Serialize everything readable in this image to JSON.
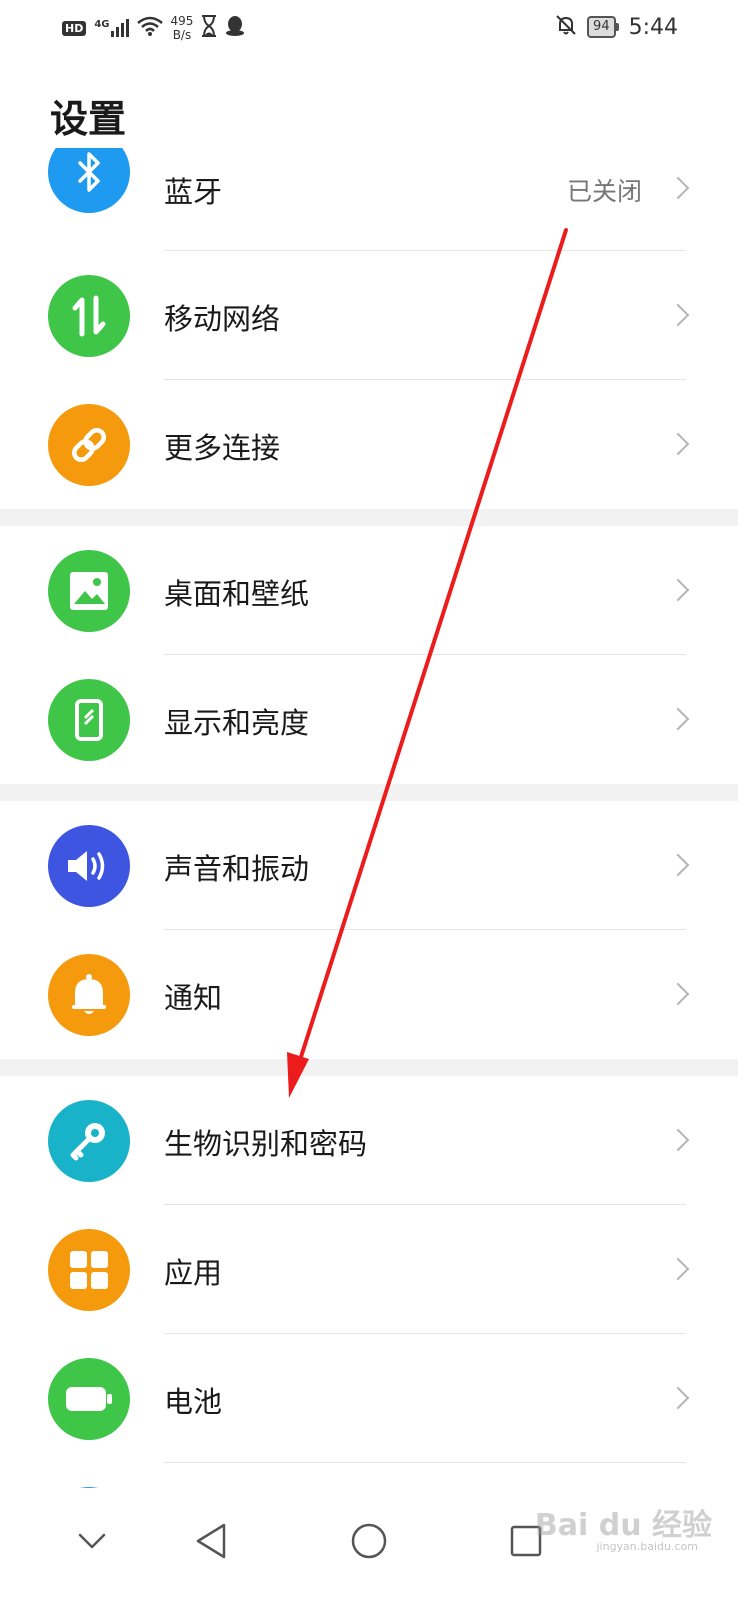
{
  "status_bar": {
    "network": "4G",
    "speed_value": "495",
    "speed_unit": "B/s",
    "battery_level": "94",
    "time": "5:44",
    "icons": [
      "hd-icon",
      "signal-icon",
      "wifi-icon",
      "hourglass-icon",
      "qq-icon",
      "mute-bell-icon",
      "battery-icon"
    ]
  },
  "page": {
    "title": "设置"
  },
  "settings": {
    "bluetooth": {
      "label": "蓝牙",
      "value": "已关闭",
      "icon": "bluetooth-icon",
      "color": "#1e9bf0"
    },
    "mobile_network": {
      "label": "移动网络",
      "icon": "arrows-updown-icon",
      "color": "#3fc548"
    },
    "more_connections": {
      "label": "更多连接",
      "icon": "link-icon",
      "color": "#f59a0c"
    },
    "home_wallpaper": {
      "label": "桌面和壁纸",
      "icon": "image-icon",
      "color": "#3fc548"
    },
    "display_brightness": {
      "label": "显示和亮度",
      "icon": "phone-display-icon",
      "color": "#3fc548"
    },
    "sound_vibration": {
      "label": "声音和振动",
      "icon": "speaker-icon",
      "color": "#3d55e0"
    },
    "notifications": {
      "label": "通知",
      "icon": "bell-icon",
      "color": "#f59a0c"
    },
    "biometrics_password": {
      "label": "生物识别和密码",
      "icon": "key-icon",
      "color": "#19b3c9"
    },
    "apps": {
      "label": "应用",
      "icon": "apps-grid-icon",
      "color": "#f59a0c"
    },
    "battery": {
      "label": "电池",
      "icon": "battery-icon",
      "color": "#3fc548"
    }
  },
  "colors": {
    "arrow": "#ec1c1c",
    "separator": "#f2f2f2"
  },
  "watermark": {
    "text": "Bai du 经验",
    "sub": "jingyan.baidu.com"
  }
}
